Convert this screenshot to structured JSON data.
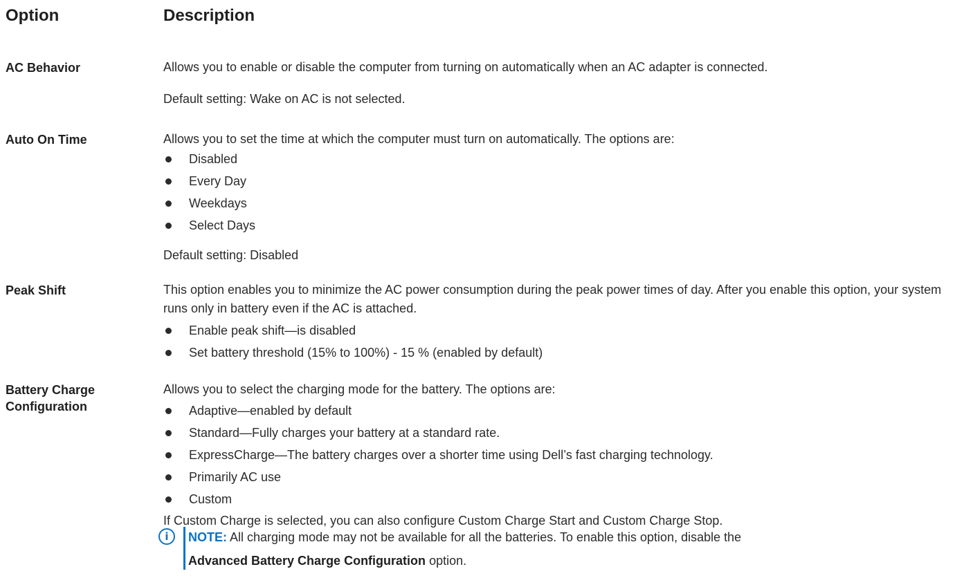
{
  "header": {
    "option": "Option",
    "description": "Description"
  },
  "rows": [
    {
      "option": "AC Behavior",
      "paragraphs": [
        "Allows you to enable or disable the computer from turning on automatically when an AC adapter is connected.",
        "Default setting: Wake on AC is not selected."
      ]
    },
    {
      "option": "Auto On Time",
      "intro": "Allows you to set the time at which the computer must turn on automatically. The options are:",
      "bullets": [
        "Disabled",
        "Every Day",
        "Weekdays",
        "Select Days"
      ],
      "outro": "Default setting: Disabled"
    },
    {
      "option": "Peak Shift",
      "intro": "This option enables you to minimize the AC power consumption during the peak power times of day. After you enable this option, your system runs only in battery even if the AC is attached.",
      "bullets": [
        "Enable peak shift—is disabled",
        "Set battery threshold (15% to 100%) - 15 % (enabled by default)"
      ]
    },
    {
      "option": "Battery Charge Configuration",
      "intro": "Allows you to select the charging mode for the battery. The options are:",
      "bullets": [
        "Adaptive—enabled by default",
        "Standard—Fully charges your battery at a standard rate.",
        "ExpressCharge—The battery charges over a shorter time using Dell’s fast charging technology.",
        "Primarily AC use",
        "Custom"
      ],
      "outro": "If Custom Charge is selected, you can also configure Custom Charge Start and Custom Charge Stop."
    }
  ],
  "note": {
    "icon": "info-icon",
    "label": "NOTE:",
    "text": "All charging mode may not be available for all the batteries. To enable this option, disable the",
    "strong": "Advanced Battery Charge Configuration",
    "tail": "option.",
    "accent_color": "#0a72c7"
  }
}
